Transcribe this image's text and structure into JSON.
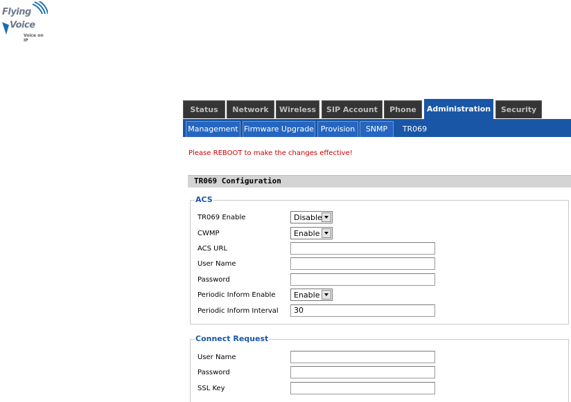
{
  "logo": {
    "line1": "Flying",
    "line2": "Voice",
    "line3": "Voice on IP"
  },
  "main_tabs": [
    {
      "label": "Status"
    },
    {
      "label": "Network"
    },
    {
      "label": "Wireless"
    },
    {
      "label": "SIP Account"
    },
    {
      "label": "Phone"
    },
    {
      "label": "Administration",
      "active": true
    },
    {
      "label": "Security"
    }
  ],
  "sub_tabs": [
    {
      "label": "Management"
    },
    {
      "label": "Firmware Upgrade"
    },
    {
      "label": "Provision"
    },
    {
      "label": "SNMP"
    },
    {
      "label": "TR069",
      "active": true
    }
  ],
  "notice": "Please REBOOT to make the changes effective!",
  "section_title": "TR069 Configuration",
  "acs": {
    "legend": "ACS",
    "tr069_enable": {
      "label": "TR069 Enable",
      "value": "Disable"
    },
    "cwmp": {
      "label": "CWMP",
      "value": "Enable"
    },
    "acs_url": {
      "label": "ACS URL",
      "value": ""
    },
    "user_name": {
      "label": "User Name",
      "value": ""
    },
    "password": {
      "label": "Password",
      "value": ""
    },
    "periodic_inform_enable": {
      "label": "Periodic Inform Enable",
      "value": "Enable"
    },
    "periodic_inform_interval": {
      "label": "Periodic Inform Interval",
      "value": "30"
    }
  },
  "connect_request": {
    "legend": "Connect Request",
    "user_name": {
      "label": "User Name",
      "value": ""
    },
    "password": {
      "label": "Password",
      "value": ""
    },
    "ssl_key": {
      "label": "SSL Key",
      "value": ""
    }
  },
  "colors": {
    "accent": "#1a56a6",
    "tab_dark": "#353535",
    "notice": "#cc0000",
    "section_bg": "#d4d4d4"
  }
}
